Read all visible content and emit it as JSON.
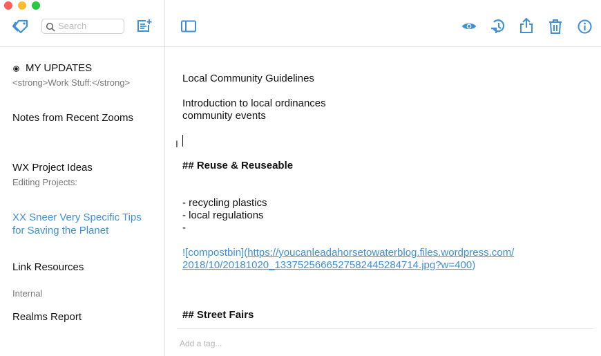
{
  "window": {
    "controls": {
      "close": "#fc5f57",
      "minimize": "#fdbc2e",
      "maximize": "#28c840"
    }
  },
  "toolbar": {
    "search_placeholder": "Search",
    "accent": "#3d8fd8",
    "icons": [
      "tags-icon",
      "search-icon",
      "new-note-icon",
      "sidebar-toggle-icon",
      "preview-eye-icon",
      "history-icon",
      "share-icon",
      "trash-icon",
      "info-icon"
    ]
  },
  "sidebar": {
    "items": [
      {
        "title": "MY UPDATES",
        "subtitle": "<strong>Work Stuff:</strong>",
        "pinned": true
      },
      {
        "title": "Notes from Recent Zooms"
      },
      {
        "title": "WX Project Ideas",
        "subtitle": "Editing Projects:"
      },
      {
        "title_line1": "XX Sneer Very Specific Tips",
        "title_line2": "for Saving the Planet",
        "selected": true
      },
      {
        "title": "Link Resources",
        "subtitle": "Internal"
      },
      {
        "title": "Realms Report"
      }
    ]
  },
  "editor": {
    "lines": {
      "l1": "Local Community Guidelines",
      "l2": "Introduction to local ordinances",
      "l3": "community events",
      "h1": "## Reuse & Reuseable",
      "b1": "- recycling plastics",
      "b2": "- local regulations",
      "b3": "-",
      "img_alt": "![compostbin](",
      "url1": "https://youcanleadahorsetowaterblog.files.wordpress.com/",
      "url2": "2018/10/20181020_133752566652758244528471​4.jpg?w=400",
      "img_close": ")",
      "h2": "## Street Fairs"
    },
    "tag_placeholder": "Add a tag..."
  }
}
